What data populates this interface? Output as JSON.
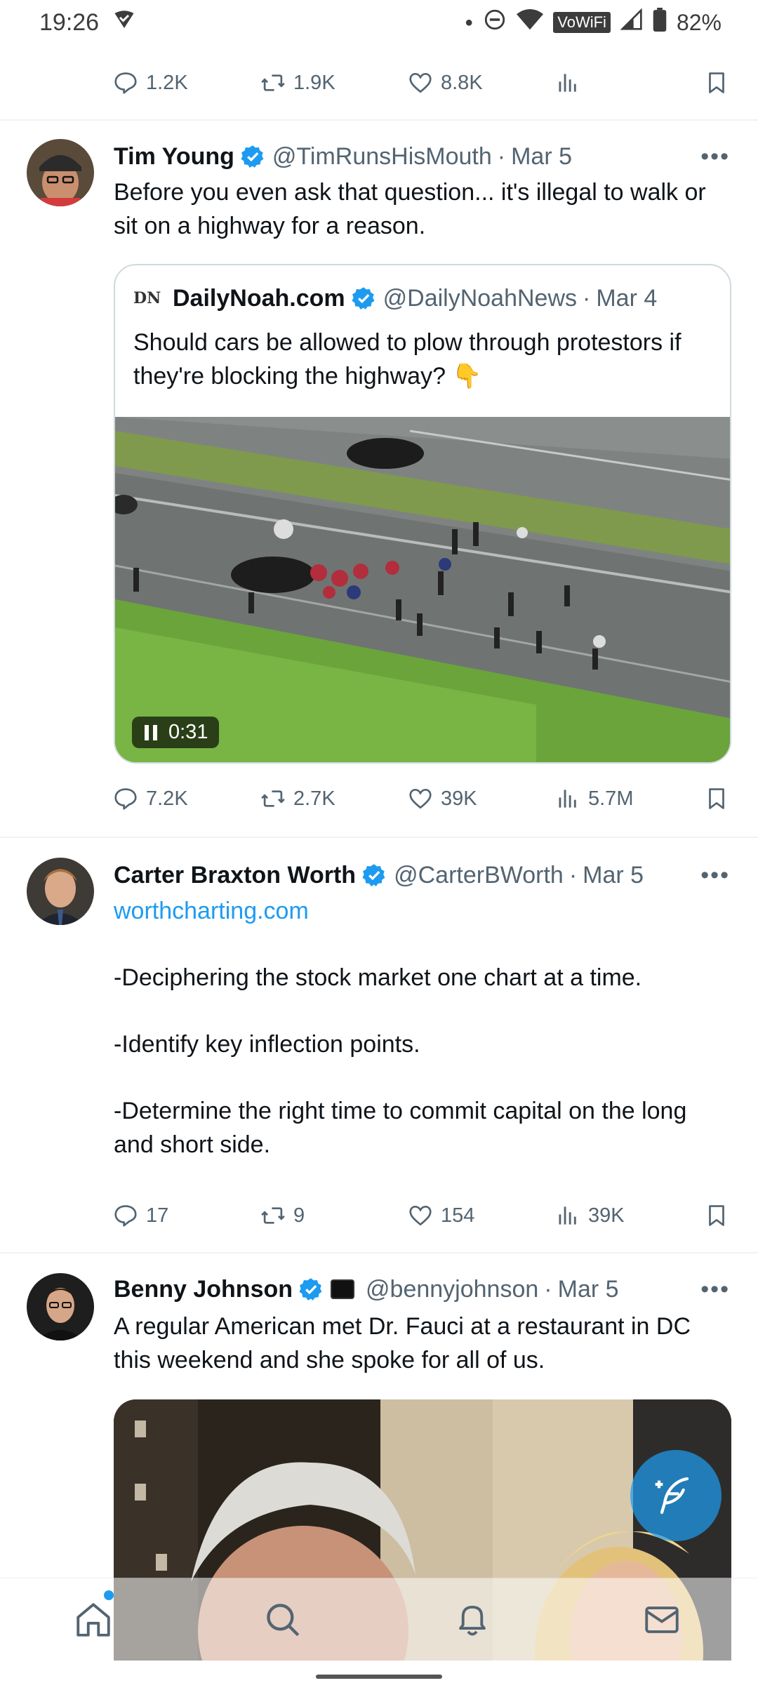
{
  "status_bar": {
    "time": "19:26",
    "network": "VoWiFi",
    "battery": "82%"
  },
  "top_actions": {
    "replies": "1.2K",
    "retweets": "1.9K",
    "likes": "8.8K"
  },
  "tweet1": {
    "name": "Tim Young",
    "handle": "@TimRunsHisMouth",
    "date": "Mar 5",
    "text": "Before you even ask that question... it's illegal to walk or sit on a highway for a reason.",
    "quote": {
      "logo": "DN",
      "name": "DailyNoah.com",
      "handle": "@DailyNoahNews",
      "date": "Mar 4",
      "text": "Should cars be allowed to plow through protestors if they're blocking the highway? 👇",
      "video_time": "0:31"
    },
    "actions": {
      "replies": "7.2K",
      "retweets": "2.7K",
      "likes": "39K",
      "views": "5.7M"
    }
  },
  "tweet2": {
    "name": "Carter Braxton Worth",
    "handle": "@CarterBWorth",
    "date": "Mar 5",
    "link": "worthcharting.com",
    "lines": [
      "-Deciphering the stock market one chart at a time.",
      "-Identify key inflection points.",
      "-Determine the right time to commit capital on the long and short side."
    ],
    "actions": {
      "replies": "17",
      "retweets": "9",
      "likes": "154",
      "views": "39K"
    }
  },
  "tweet3": {
    "name": "Benny Johnson",
    "handle": "@bennyjohnson",
    "date": "Mar 5",
    "text": "A regular American met Dr. Fauci at a restaurant in DC this weekend and she spoke for all of us."
  },
  "dot_separator": "·",
  "more": "•••",
  "colors": {
    "accent": "#1d9bf0",
    "text": "#0f1419",
    "secondary": "#536471"
  }
}
